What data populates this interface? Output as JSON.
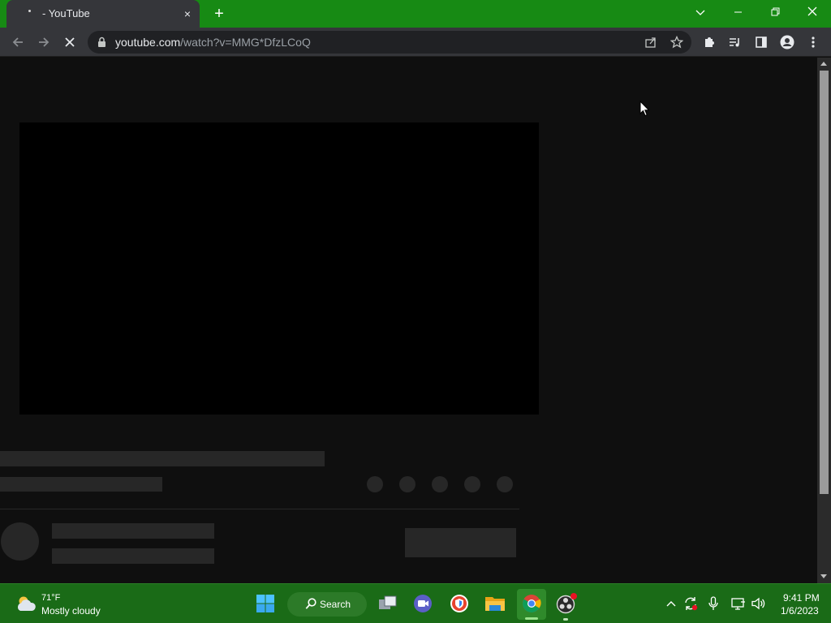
{
  "browser": {
    "tab": {
      "title": " - YouTube",
      "close_glyph": "×"
    },
    "new_tab_glyph": "+",
    "window_controls": {
      "tab_search_glyph": "⌄",
      "minimize_glyph": "—",
      "restore_glyph": "❐",
      "close_glyph": "✕"
    },
    "omnibox": {
      "url_host": "youtube.com",
      "url_path": "/watch?v=MMG*DfzLCoQ"
    },
    "icons": {
      "back": "arrow-left-icon",
      "forward": "arrow-right-icon",
      "stop": "stop-loading-icon",
      "lock": "lock-icon",
      "share": "share-icon",
      "bookmark": "star-icon",
      "extensions": "puzzle-icon",
      "media": "media-queue-icon",
      "side_panel": "side-panel-icon",
      "profile": "profile-icon",
      "menu": "kebab-menu-icon"
    }
  },
  "page": {
    "state": "loading-skeleton",
    "colors": {
      "background": "#0f0f0f",
      "player": "#000000",
      "skeleton": "#272727"
    }
  },
  "taskbar": {
    "weather": {
      "temp": "71°F",
      "condition": "Mostly cloudy"
    },
    "search_label": "Search",
    "apps": [
      "start-icon",
      "search-icon",
      "task-view-icon",
      "teams-chat-icon",
      "vpn-shield-icon",
      "file-explorer-icon",
      "chrome-icon",
      "obs-icon"
    ],
    "tray": [
      "chevron-up-icon",
      "sync-icon",
      "microphone-icon",
      "network-icon",
      "volume-icon"
    ],
    "clock": {
      "time": "9:41 PM",
      "date": "1/6/2023"
    },
    "accent": "#1a6b17"
  }
}
